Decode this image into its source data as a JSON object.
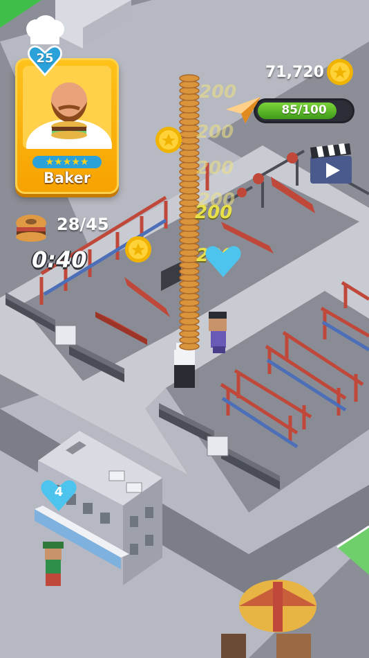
{
  "chef_card": {
    "level": "25",
    "name": "Baker",
    "stars": "★★★★★"
  },
  "currency": {
    "coins": "71,720"
  },
  "progress": {
    "label": "85/100",
    "value": 85,
    "max": 100
  },
  "order": {
    "count": "28/45",
    "timer": "0:40"
  },
  "popups": [
    "200",
    "200",
    "200",
    "200",
    "200",
    "200"
  ],
  "building_marker": {
    "count": "4"
  },
  "colors": {
    "card_orange": "#ffb300",
    "badge_blue": "#2aa1d9",
    "progress_green": "#5dbb2a",
    "bench_red": "#c0483a",
    "rail_blue": "#4d6fb8"
  },
  "icons": {
    "coin": "coin-icon",
    "plane": "paper-plane-icon",
    "video": "clapperboard-video-icon",
    "order": "bagel-burger-icon",
    "heart": "heart-icon"
  }
}
